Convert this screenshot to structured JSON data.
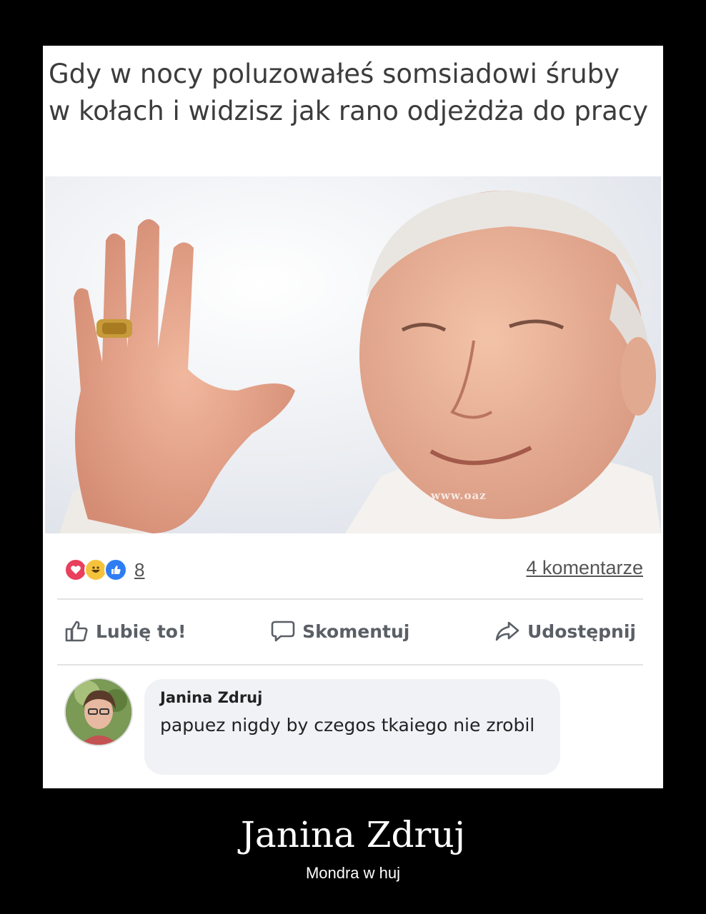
{
  "post": {
    "caption": "Gdy w nocy poluzowałeś somsiadowi śruby w kołach i widzisz jak rano odjeżdża do pracy",
    "image_watermark": "www.oaz",
    "reactions": {
      "types": [
        "love-icon",
        "haha-icon",
        "like-icon"
      ],
      "count": "8"
    },
    "comments_count": "4 komentarze",
    "actions": {
      "like": "Lubię to!",
      "comment": "Skomentuj",
      "share": "Udostępnij"
    }
  },
  "comment": {
    "author": "Janina Zdruj",
    "text": "papuez nigdy by czegos tkaiego nie zrobil"
  },
  "footer": {
    "title": "Janina Zdruj",
    "subtitle": "Mondra w huj"
  },
  "colors": {
    "background": "#000000",
    "card": "#ffffff",
    "bubble": "#f0f2f5",
    "love": "#e8405d",
    "haha": "#f5c33b",
    "like": "#2e7ef2"
  }
}
